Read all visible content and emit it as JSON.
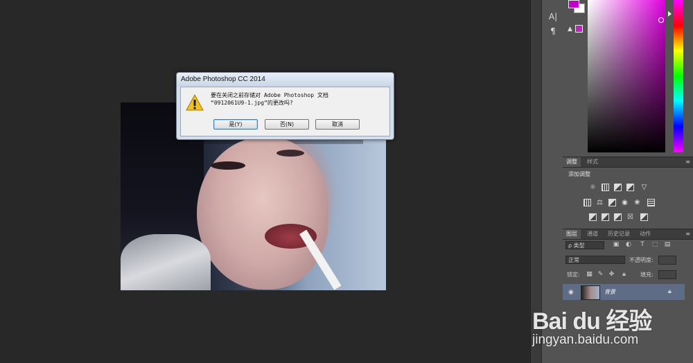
{
  "dialog": {
    "title": "Adobe Photoshop CC 2014",
    "message_line1": "要在关闭之前存储对 Adobe Photoshop 文档",
    "message_line2": "“0912061U9-1.jpg”的更改吗?",
    "buttons": {
      "yes": "是(Y)",
      "no": "否(N)",
      "cancel": "取消"
    }
  },
  "tools": {
    "char": "A|",
    "para": "¶"
  },
  "adjustments": {
    "tabs": [
      "调整",
      "样式"
    ],
    "title": "添加调整"
  },
  "layers": {
    "tabs": [
      "图层",
      "通道",
      "历史记录",
      "动作"
    ],
    "filter_type": "ρ 类型",
    "blend_mode": "正常",
    "opacity_label": "不透明度:",
    "lock_label": "锁定:",
    "fill_label": "填充:",
    "rows": [
      {
        "name": "背景"
      }
    ]
  },
  "watermark": {
    "brand": "Bai du 经验",
    "url": "jingyan.baidu.com"
  },
  "colors": {
    "foreground": "#c000c8",
    "hue_accent": "#e000e0",
    "selected_layer": "#5e6d85"
  }
}
